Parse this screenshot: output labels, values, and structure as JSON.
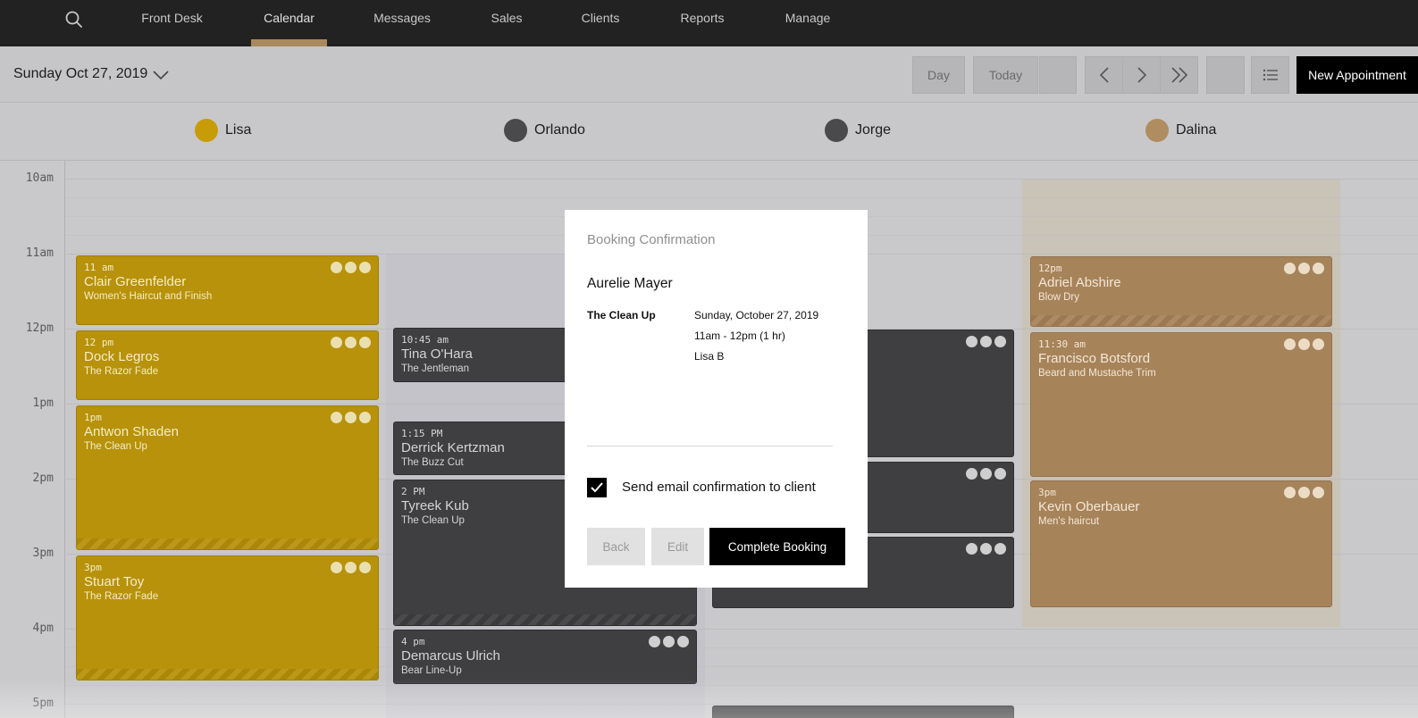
{
  "nav": {
    "search_icon": "search-icon",
    "items": [
      {
        "label": "Front Desk"
      },
      {
        "label": "Calendar",
        "active": true
      },
      {
        "label": "Messages"
      },
      {
        "label": "Sales"
      },
      {
        "label": "Clients"
      },
      {
        "label": "Reports"
      },
      {
        "label": "Manage"
      }
    ]
  },
  "toolbar": {
    "date": "Sunday Oct 27, 2019",
    "day_label": "Day",
    "today_label": "Today",
    "new_appointment_label": "New Appointment"
  },
  "staff": [
    {
      "name": "Lisa",
      "color": "#c79c06"
    },
    {
      "name": "Orlando",
      "color": "#4a4a4c"
    },
    {
      "name": "Jorge",
      "color": "#4a4a4c"
    },
    {
      "name": "Dalina",
      "color": "#b08d60"
    }
  ],
  "times": [
    "10am",
    "11am",
    "12pm",
    "1pm",
    "2pm",
    "3pm",
    "4pm",
    "5pm"
  ],
  "appointments": {
    "lisa": [
      {
        "time": "11 am",
        "name": "Clair Greenfelder",
        "service": "Women's Haircut and Finish"
      },
      {
        "time": "12 pm",
        "name": "Dock Legros",
        "service": "The Razor Fade"
      },
      {
        "time": "1pm",
        "name": "Antwon Shaden",
        "service": "The Clean Up"
      },
      {
        "time": "3pm",
        "name": "Stuart Toy",
        "service": "The Razor Fade"
      }
    ],
    "orlando": [
      {
        "time": "10:45 am",
        "name": "Tina O'Hara",
        "service": "The Jentleman"
      },
      {
        "time": "1:15 PM",
        "name": "Derrick Kertzman",
        "service": "The Buzz Cut"
      },
      {
        "time": "2 PM",
        "name": "Tyreek Kub",
        "service": "The Clean Up"
      },
      {
        "time": "4 pm",
        "name": "Demarcus Ulrich",
        "service": "Bear Line-Up"
      }
    ],
    "dalina": [
      {
        "time": "12pm",
        "name": "Adriel Abshire",
        "service": "Blow Dry"
      },
      {
        "time": "11:30 am",
        "name": "Francisco Botsford",
        "service": "Beard and Mustache Trim"
      },
      {
        "time": "3pm",
        "name": "Kevin Oberbauer",
        "service": "Men's haircut"
      }
    ]
  },
  "modal": {
    "title": "Booking Confirmation",
    "client": "Aurelie Mayer",
    "service": "The Clean Up",
    "date": "Sunday, October 27, 2019",
    "time": "11am - 12pm (1 hr)",
    "staff": "Lisa B",
    "checkbox_label": "Send email confirmation to client",
    "checkbox_checked": true,
    "back_label": "Back",
    "edit_label": "Edit",
    "complete_label": "Complete Booking"
  },
  "colors": {
    "lisa": "#b7920a",
    "orlando": "#3f3f41",
    "dalina": "#a7835a",
    "nav_accent": "#a98a5e"
  }
}
